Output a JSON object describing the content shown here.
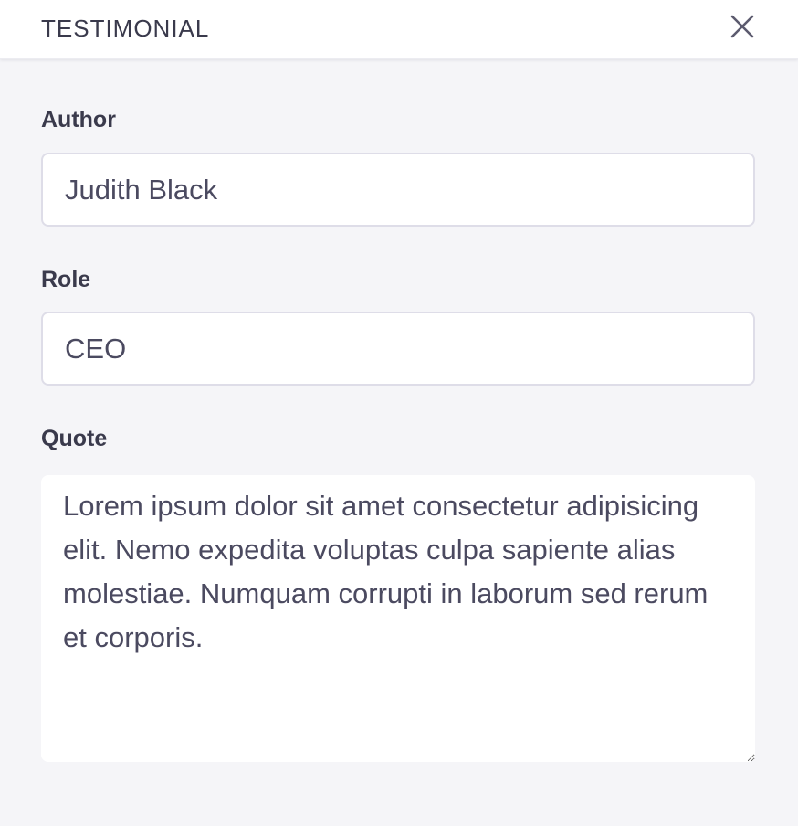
{
  "header": {
    "title": "TESTIMONIAL",
    "close_icon": "close-icon"
  },
  "form": {
    "author": {
      "label": "Author",
      "value": "Judith Black"
    },
    "role": {
      "label": "Role",
      "value": "CEO"
    },
    "quote": {
      "label": "Quote",
      "value": "Lorem ipsum dolor sit amet consectetur adipisicing elit. Nemo expedita voluptas culpa sapiente alias molestiae. Numquam corrupti in laborum sed rerum et corporis."
    }
  },
  "colors": {
    "background": "#f5f5f8",
    "header_background": "#ffffff",
    "input_border": "#dedde8",
    "text": "#3a3a4c"
  }
}
